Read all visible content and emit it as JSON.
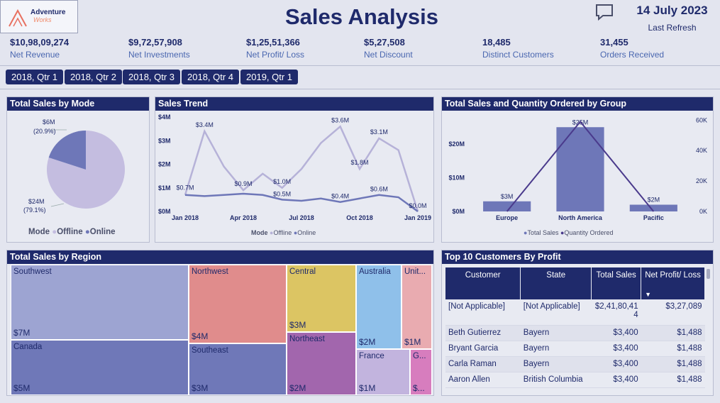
{
  "header": {
    "title": "Sales Analysis",
    "date": "14 July 2023",
    "refresh": "Last Refresh",
    "logo_line1": "Adventure",
    "logo_line2": "Works"
  },
  "kpis": [
    {
      "value": "$10,98,09,274",
      "label": "Net Revenue"
    },
    {
      "value": "$9,72,57,908",
      "label": "Net Investments"
    },
    {
      "value": "$1,25,51,366",
      "label": "Net Profit/ Loss"
    },
    {
      "value": "$5,27,508",
      "label": "Net Discount"
    },
    {
      "value": "18,485",
      "label": "Distinct Customers"
    },
    {
      "value": "31,455",
      "label": "Orders Received"
    }
  ],
  "quarters": [
    "2018, Qtr 1",
    "2018, Qtr 2",
    "2018, Qtr 3",
    "2018, Qtr 4",
    "2019, Qtr 1"
  ],
  "mode_panel": {
    "title": "Total Sales by Mode",
    "legend_title": "Mode",
    "legend": [
      "Offline",
      "Online"
    ],
    "label_online_value": "$6M",
    "label_online_pct": "(20.9%)",
    "label_offline_value": "$24M",
    "label_offline_pct": "(79.1%)"
  },
  "trend_panel": {
    "title": "Sales Trend",
    "legend_title": "Mode",
    "legend": [
      "Offline",
      "Online"
    ]
  },
  "group_panel": {
    "title": "Total Sales and Quantity Ordered by Group",
    "legend": [
      "Total Sales",
      "Quantity Ordered"
    ]
  },
  "region_panel": {
    "title": "Total Sales by Region",
    "regions": [
      {
        "name": "Southwest",
        "value": "$7M"
      },
      {
        "name": "Canada",
        "value": "$5M"
      },
      {
        "name": "Northwest",
        "value": "$4M"
      },
      {
        "name": "Southeast",
        "value": "$3M"
      },
      {
        "name": "Central",
        "value": "$3M"
      },
      {
        "name": "Northeast",
        "value": "$2M"
      },
      {
        "name": "Australia",
        "value": "$2M"
      },
      {
        "name": "France",
        "value": "$1M"
      },
      {
        "name": "Unit...",
        "value": "$1M"
      },
      {
        "name": "G...",
        "value": "$..."
      }
    ]
  },
  "customers_panel": {
    "title": "Top 10 Customers By Profit",
    "columns": [
      "Customer",
      "State",
      "Total Sales",
      "Net Profit/ Loss"
    ],
    "rows": [
      [
        "[Not Applicable]",
        "[Not Applicable]",
        "$2,41,80,41 4",
        "$3,27,089"
      ],
      [
        "Beth Gutierrez",
        "Bayern",
        "$3,400",
        "$1,488"
      ],
      [
        "Bryant Garcia",
        "Bayern",
        "$3,400",
        "$1,488"
      ],
      [
        "Carla Raman",
        "Bayern",
        "$3,400",
        "$1,488"
      ],
      [
        "Aaron Allen",
        "British Columbia",
        "$3,400",
        "$1,488"
      ]
    ]
  },
  "chart_data": [
    {
      "type": "pie",
      "title": "Total Sales by Mode",
      "categories": [
        "Offline",
        "Online"
      ],
      "values": [
        24,
        6
      ],
      "percentages": [
        79.1,
        20.9
      ],
      "colors": [
        "#c4bde0",
        "#6e77b8"
      ]
    },
    {
      "type": "line",
      "title": "Sales Trend",
      "x": [
        "Jan 2018",
        "Feb 2018",
        "Mar 2018",
        "Apr 2018",
        "May 2018",
        "Jun 2018",
        "Jul 2018",
        "Aug 2018",
        "Sep 2018",
        "Oct 2018",
        "Nov 2018",
        "Dec 2018",
        "Jan 2019"
      ],
      "x_ticks": [
        "Jan 2018",
        "Apr 2018",
        "Jul 2018",
        "Oct 2018",
        "Jan 2019"
      ],
      "y_ticks": [
        "$0M",
        "$1M",
        "$2M",
        "$3M",
        "$4M"
      ],
      "ylim": [
        0,
        4
      ],
      "series": [
        {
          "name": "Offline",
          "color": "#b6b2d8",
          "values": [
            0.7,
            3.4,
            1.9,
            0.9,
            1.6,
            1.0,
            1.8,
            2.9,
            3.6,
            1.8,
            3.1,
            2.6,
            0.0
          ]
        },
        {
          "name": "Online",
          "color": "#6e77b8",
          "values": [
            0.7,
            0.65,
            0.7,
            0.75,
            0.7,
            0.5,
            0.45,
            0.55,
            0.4,
            0.55,
            0.7,
            0.6,
            0.0
          ]
        }
      ],
      "data_labels": [
        {
          "series": "Offline",
          "i": 1,
          "text": "$3.4M"
        },
        {
          "series": "Offline",
          "i": 3,
          "text": "$0.9M"
        },
        {
          "series": "Offline",
          "i": 5,
          "text": "$1.0M"
        },
        {
          "series": "Offline",
          "i": 8,
          "text": "$3.6M"
        },
        {
          "series": "Offline",
          "i": 9,
          "text": "$1.8M"
        },
        {
          "series": "Offline",
          "i": 10,
          "text": "$3.1M"
        },
        {
          "series": "Online",
          "i": 0,
          "text": "$0.7M"
        },
        {
          "series": "Online",
          "i": 5,
          "text": "$0.5M"
        },
        {
          "series": "Online",
          "i": 8,
          "text": "$0.4M"
        },
        {
          "series": "Online",
          "i": 10,
          "text": "$0.6M"
        },
        {
          "series": "Online",
          "i": 12,
          "text": "$0.0M"
        }
      ]
    },
    {
      "type": "bar",
      "title": "Total Sales and Quantity Ordered by Group",
      "categories": [
        "Europe",
        "North America",
        "Pacific"
      ],
      "series": [
        {
          "name": "Total Sales",
          "color": "#6e77b8",
          "values": [
            3,
            25,
            2
          ],
          "labels": [
            "$3M",
            "$25M",
            "$2M"
          ]
        },
        {
          "name": "Quantity Ordered",
          "color": "#4a3a8c",
          "values": [
            0,
            59000,
            0
          ]
        }
      ],
      "y_left_ticks": [
        "$0M",
        "$10M",
        "$20M"
      ],
      "y_right_ticks": [
        "0K",
        "20K",
        "40K",
        "60K"
      ],
      "ylim_left": [
        0,
        28
      ],
      "ylim_right": [
        0,
        62000
      ]
    }
  ]
}
